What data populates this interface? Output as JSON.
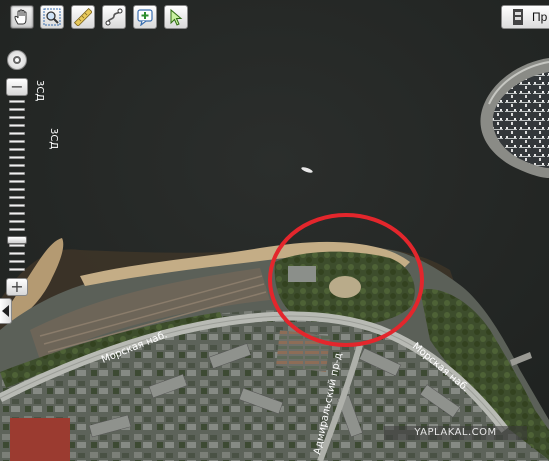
{
  "toolbar": {
    "tools": [
      {
        "name": "hand-tool",
        "icon": "hand-icon",
        "active": true
      },
      {
        "name": "zoom-rect-tool",
        "icon": "magnifier-icon",
        "active": false
      },
      {
        "name": "ruler-tool",
        "icon": "ruler-icon",
        "active": false
      },
      {
        "name": "route-tool",
        "icon": "route-icon",
        "active": false
      },
      {
        "name": "add-point-tool",
        "icon": "add-point-icon",
        "active": false
      },
      {
        "name": "select-tool",
        "icon": "cursor-icon",
        "active": false
      }
    ],
    "layers_label": "Пр"
  },
  "zoom": {
    "home_icon": "compass-icon",
    "minus_label": "−",
    "plus_label": "+",
    "level_fraction": 0.82,
    "level_labels": [
      "3СД",
      "3СД"
    ]
  },
  "map": {
    "streets": [
      "Морская наб.",
      "Морская наб.",
      "Адмиральский пр-д"
    ],
    "highlight_color": "#e3262c"
  },
  "watermark": "YAPLAKAL.COM"
}
